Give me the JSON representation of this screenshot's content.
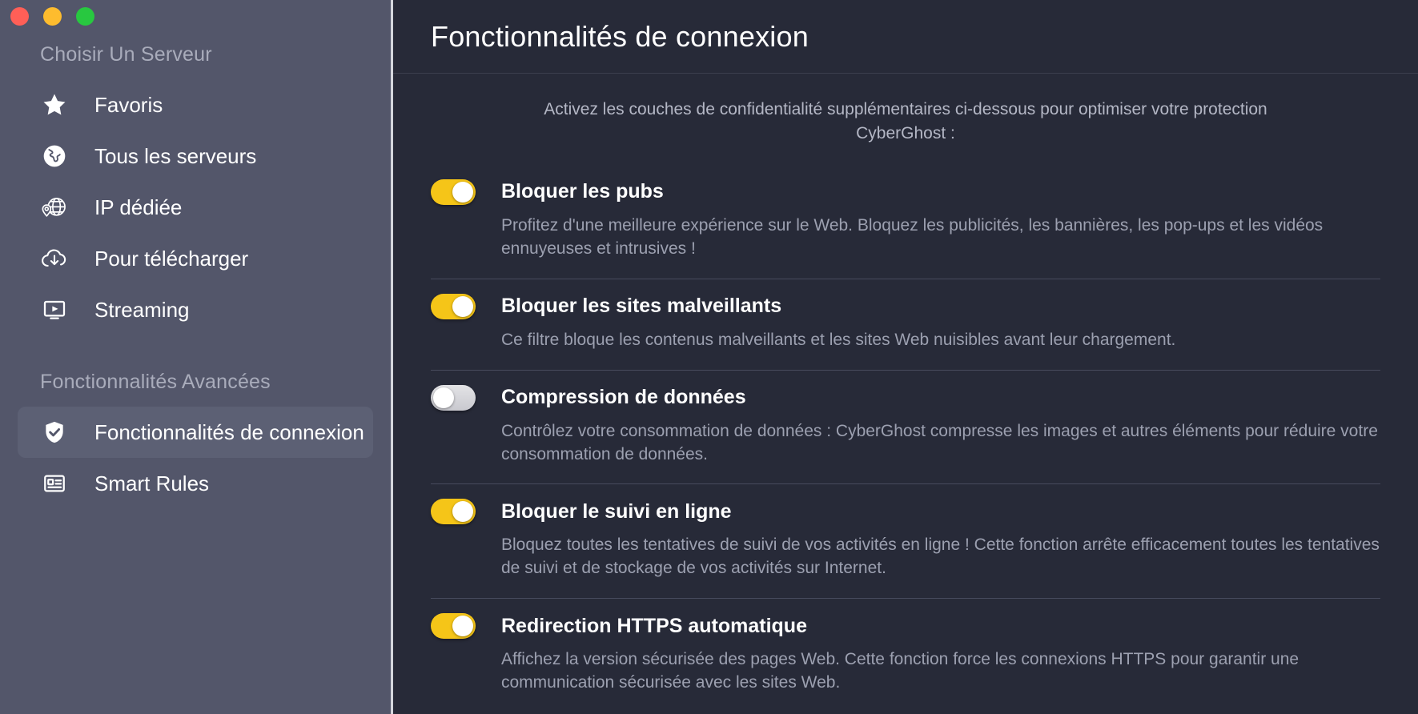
{
  "window": {
    "traffic_lights": [
      {
        "name": "close",
        "color": "#ff5f57"
      },
      {
        "name": "minimize",
        "color": "#febc2e"
      },
      {
        "name": "maximize",
        "color": "#28c840"
      }
    ]
  },
  "sidebar": {
    "sections": [
      {
        "title": "Choisir Un Serveur",
        "items": [
          {
            "label": "Favoris",
            "icon": "star-icon",
            "selected": false
          },
          {
            "label": "Tous les serveurs",
            "icon": "globe-solid-icon",
            "selected": false
          },
          {
            "label": "IP dédiée",
            "icon": "globe-pin-icon",
            "selected": false
          },
          {
            "label": "Pour télécharger",
            "icon": "cloud-download-icon",
            "selected": false
          },
          {
            "label": "Streaming",
            "icon": "play-screen-icon",
            "selected": false
          }
        ]
      },
      {
        "title": "Fonctionnalités Avancées",
        "items": [
          {
            "label": "Fonctionnalités de connexion",
            "icon": "shield-check-icon",
            "selected": true
          },
          {
            "label": "Smart Rules",
            "icon": "rules-list-icon",
            "selected": false
          }
        ]
      }
    ]
  },
  "main": {
    "title": "Fonctionnalités de connexion",
    "intro": "Activez les couches de confidentialité supplémentaires ci-dessous pour optimiser votre protection CyberGhost :",
    "features": [
      {
        "title": "Bloquer les pubs",
        "description": "Profitez d'une meilleure expérience sur le Web. Bloquez les publicités, les bannières, les pop-ups et les vidéos ennuyeuses et intrusives !",
        "enabled": true,
        "toggle_state": "on"
      },
      {
        "title": "Bloquer les sites malveillants",
        "description": "Ce filtre bloque les contenus malveillants et les sites Web nuisibles avant leur chargement.",
        "enabled": true,
        "toggle_state": "on"
      },
      {
        "title": "Compression de données",
        "description": "Contrôlez votre consommation de données : CyberGhost compresse les images et autres éléments pour réduire votre consommation de données.",
        "enabled": false,
        "toggle_state": "off"
      },
      {
        "title": "Bloquer le suivi en ligne",
        "description": "Bloquez toutes les tentatives de suivi de vos activités en ligne ! Cette fonction arrête efficacement toutes les tentatives de suivi et de stockage de vos activités sur Internet.",
        "enabled": true,
        "toggle_state": "on"
      },
      {
        "title": "Redirection HTTPS automatique",
        "description": "Affichez la version sécurisée des pages Web. Cette fonction force les connexions HTTPS pour garantir une communication sécurisée avec les sites Web.",
        "enabled": true,
        "toggle_state": "on"
      }
    ]
  },
  "colors": {
    "sidebar_bg": "#53566a",
    "main_bg": "#272a38",
    "accent_on": "#f5c518",
    "accent_off": "#d8d8dd",
    "text_primary": "#ffffff",
    "text_secondary": "#9ca0b0",
    "selected_item_bg": "#5c6074"
  }
}
